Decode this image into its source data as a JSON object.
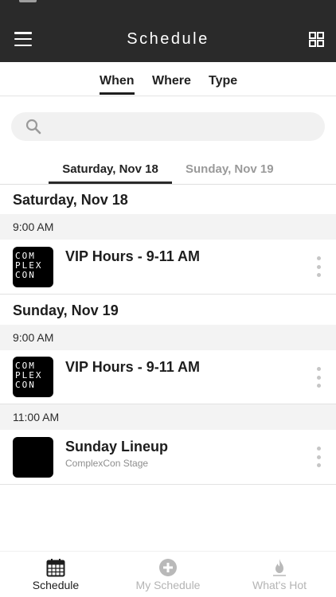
{
  "header": {
    "title": "Schedule"
  },
  "tabs": [
    {
      "label": "When",
      "active": true
    },
    {
      "label": "Where",
      "active": false
    },
    {
      "label": "Type",
      "active": false
    }
  ],
  "search": {
    "placeholder": "",
    "value": ""
  },
  "day_tabs": [
    {
      "label": "Saturday, Nov 18",
      "active": true
    },
    {
      "label": "Sunday, Nov 19",
      "active": false
    }
  ],
  "sections": [
    {
      "day": "Saturday, Nov 18",
      "slots": [
        {
          "time": "9:00 AM",
          "events": [
            {
              "title": "VIP Hours - 9-11 AM",
              "subtitle": "",
              "thumb": "complexcon-logo"
            }
          ]
        }
      ]
    },
    {
      "day": "Sunday, Nov 19",
      "slots": [
        {
          "time": "9:00 AM",
          "events": [
            {
              "title": "VIP Hours - 9-11 AM",
              "subtitle": "",
              "thumb": "complexcon-logo"
            }
          ]
        },
        {
          "time": "11:00 AM",
          "events": [
            {
              "title": "Sunday Lineup",
              "subtitle": "ComplexCon Stage",
              "thumb": "black-square"
            }
          ]
        }
      ]
    }
  ],
  "logo_text": {
    "line1": "COM",
    "line2": "PLEX",
    "line3": "CON"
  },
  "bottom_nav": [
    {
      "label": "Schedule",
      "icon": "calendar-icon",
      "active": true
    },
    {
      "label": "My Schedule",
      "icon": "plus-circle-icon",
      "active": false
    },
    {
      "label": "What's Hot",
      "icon": "flame-icon",
      "active": false
    }
  ],
  "colors": {
    "header_bg": "#2a2a2a",
    "active_text": "#1d1d1d",
    "inactive_text": "#9a9a9a",
    "band_bg": "#f3f3f3"
  }
}
